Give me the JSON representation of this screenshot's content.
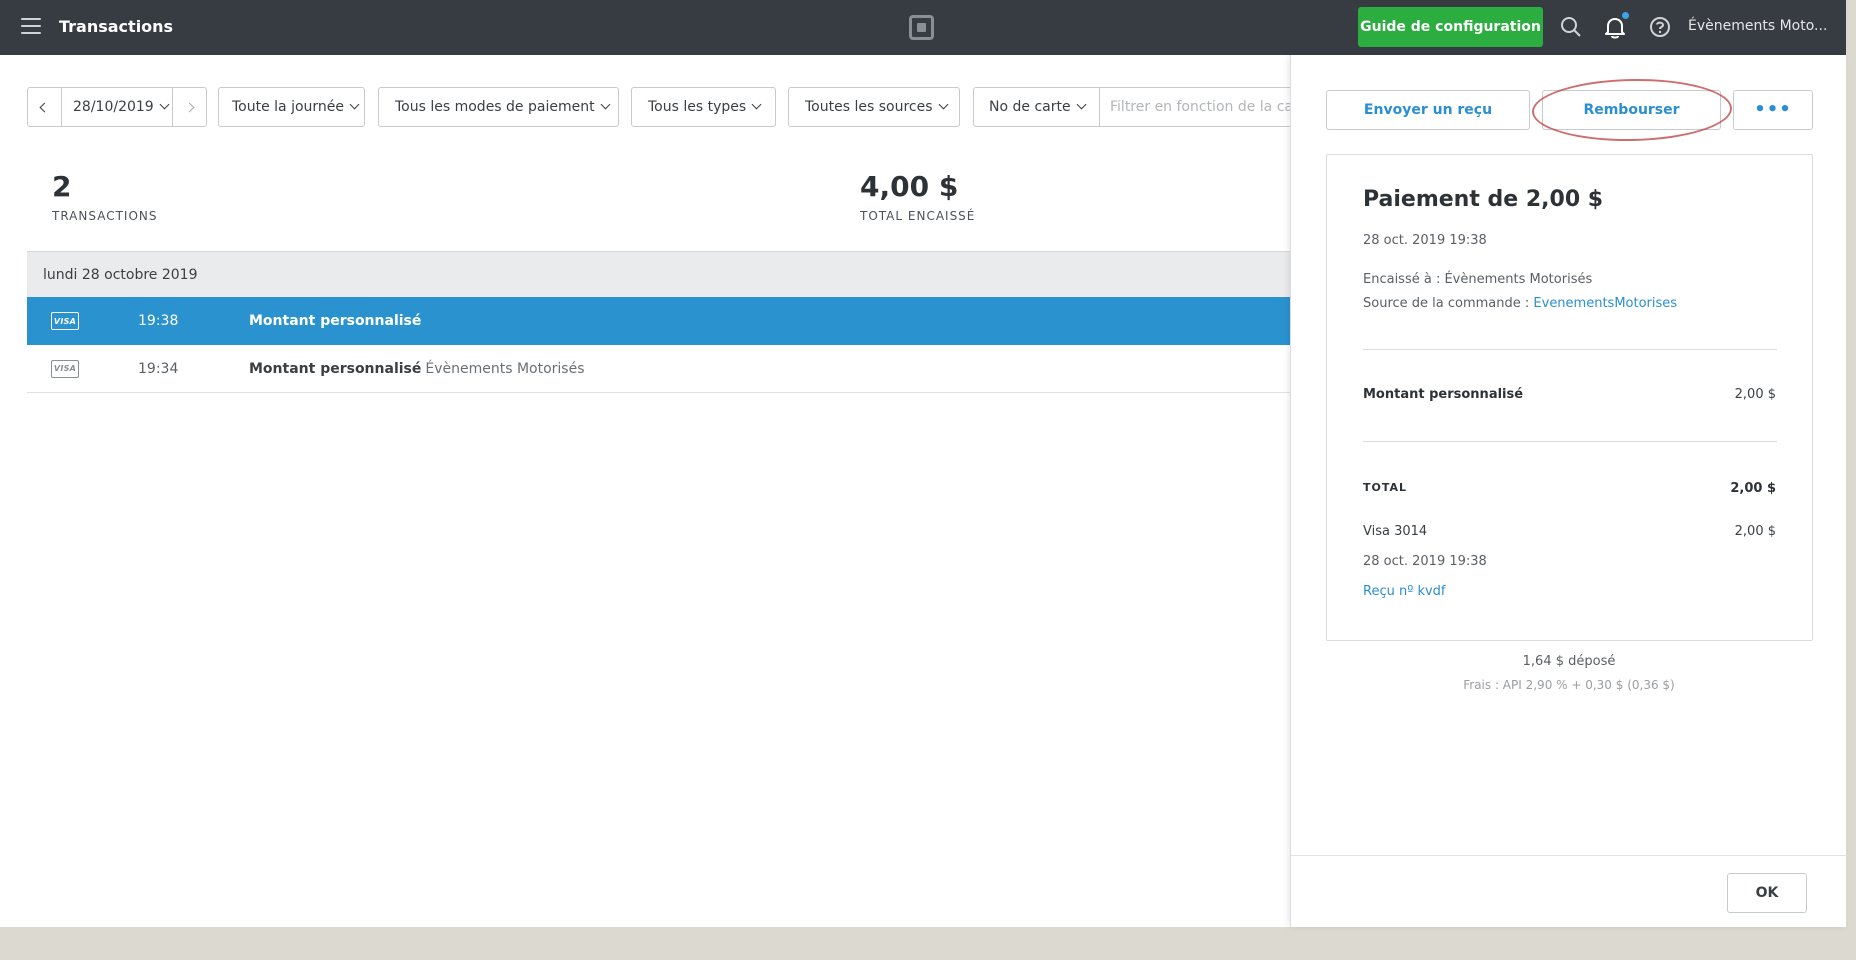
{
  "header": {
    "title": "Transactions",
    "setup_button": "Guide de configuration",
    "account_name": "Évènements Moto...",
    "bg_color": "#373c42",
    "accent_green": "#2bae3f"
  },
  "filters": {
    "date": "28/10/2019",
    "time_range": "Toute la journée",
    "payment_modes": "Tous les modes de paiement",
    "types": "Tous les types",
    "sources": "Toutes les sources",
    "card_field": "No de carte",
    "card_placeholder": "Filtrer en fonction de la carte"
  },
  "stats": {
    "count": "2",
    "count_label": "TRANSACTIONS",
    "total": "4,00 $",
    "total_label": "TOTAL ENCAISSÉ"
  },
  "list": {
    "day_header": "lundi 28 octobre 2019",
    "rows": [
      {
        "card_brand": "VISA",
        "time": "19:38",
        "description": "Montant personnalisé",
        "sub": "",
        "selected": true
      },
      {
        "card_brand": "VISA",
        "time": "19:34",
        "description": "Montant personnalisé",
        "sub": "Évènements Motorisés",
        "selected": false
      }
    ],
    "selected_color": "#2a93cf"
  },
  "panel": {
    "send_receipt": "Envoyer un reçu",
    "refund": "Rembourser",
    "more": "•••",
    "title": "Paiement de 2,00 $",
    "date": "28 oct. 2019 19:38",
    "collected_at": "Encaissé à : Évènements Motorisés",
    "source_label": "Source de la commande : ",
    "source_link": "EvenementsMotorises",
    "item_name": "Montant personnalisé",
    "item_amount": "2,00 $",
    "total_label": "TOTAL",
    "total_amount": "2,00 $",
    "card_line": "Visa 3014",
    "card_amount": "2,00 $",
    "card_date": "28 oct. 2019 19:38",
    "receipt_link": "Reçu nº kvdf",
    "deposited": "1,64 $ déposé",
    "fees": "Frais : API 2,90 % + 0,30 $ (0,36 $)",
    "ok": "OK",
    "link_color": "#2a8ed2"
  }
}
